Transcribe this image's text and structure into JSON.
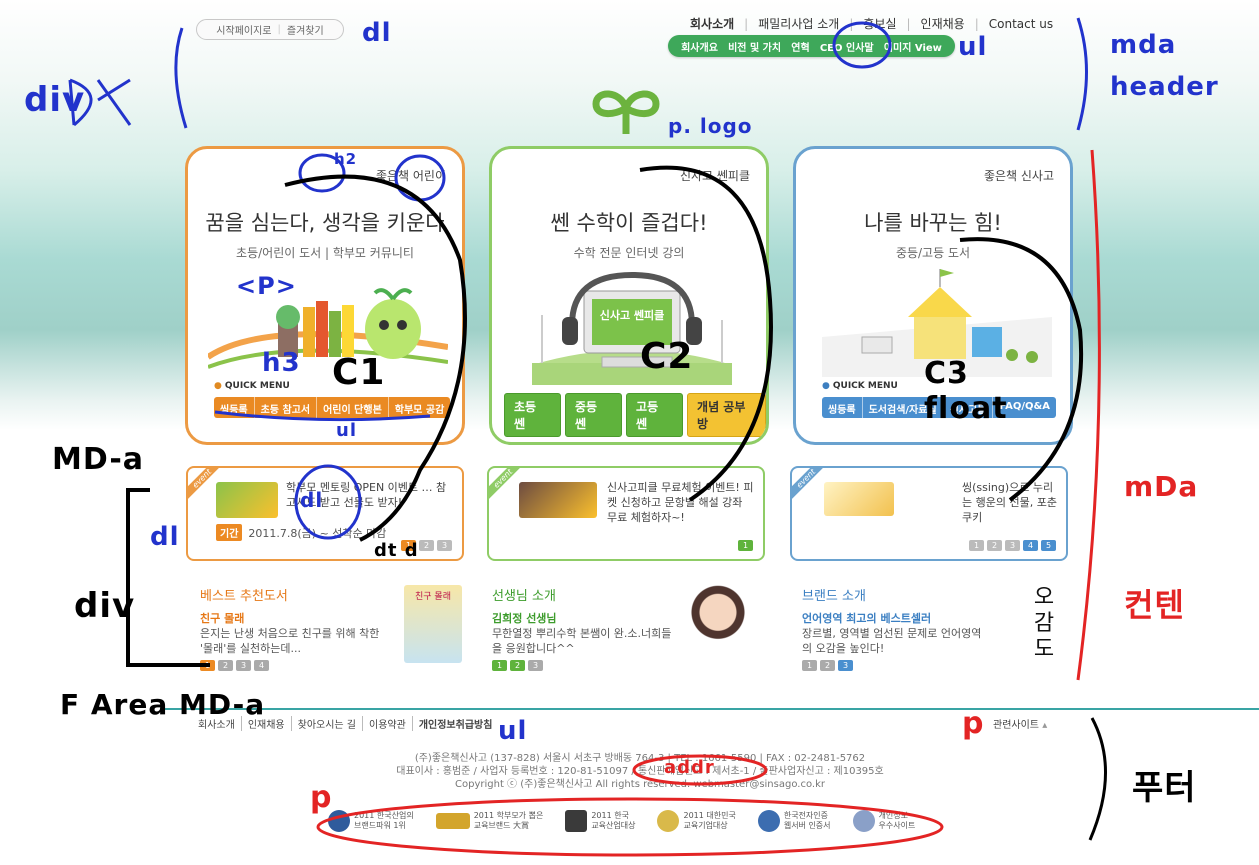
{
  "util": {
    "start_page": "시작페이지로",
    "bookmark": "즐겨찾기"
  },
  "gnb": {
    "items": [
      "회사소개",
      "패밀리사업 소개",
      "홍보실",
      "인재채용",
      "Contact us"
    ],
    "sub": [
      "회사개요",
      "비전 및 가치",
      "연혁",
      "CEO 인사말",
      "이미지 View"
    ]
  },
  "cards": [
    {
      "brand": "좋은책 어린이",
      "title": "꿈을 심는다, 생각을 키운다",
      "subtitle": "초등/어린이 도서 | 학부모 커뮤니티",
      "quick": "QUICK MENU",
      "menu": [
        "씽등록",
        "초등 참고서",
        "어린이 단행본",
        "학부모 공감"
      ]
    },
    {
      "brand": "신사고 쎈피클",
      "title": "쎈 수학이 즐겁다!",
      "subtitle": "수학 전문 인터넷 강의",
      "screen": "신사고 쎈피클",
      "menu": [
        "초등 쎈",
        "중등 쎈",
        "고등 쎈",
        "개념 공부방"
      ]
    },
    {
      "brand": "좋은책 신사고",
      "title": "나를 바꾸는 힘!",
      "subtitle": "중등/고등 도서",
      "quick": "QUICK MENU",
      "menu": [
        "씽등록",
        "도서검색/자료실",
        "신사고몰",
        "FAQ/Q&A"
      ]
    }
  ],
  "events": [
    {
      "label": "event",
      "text": "학부모 멘토링 OPEN 이벤트 … 참고서도 받고 선물도 받자!",
      "period_label": "기간",
      "period": "2011.7.8(금) ~ 선착순 마감",
      "pages": [
        "1",
        "2",
        "3"
      ]
    },
    {
      "label": "event",
      "text": "신사고피클 무료체험 이벤트! 피켓 신청하고 문항별 해설 강좌 무료 체험하자~!",
      "pages": [
        "1"
      ]
    },
    {
      "label": "event",
      "text": "씽(ssing)으로 누리는 행운의 선물, 포춘쿠키",
      "pages": [
        "1",
        "2",
        "3",
        "4",
        "5"
      ]
    }
  ],
  "info": [
    {
      "title": "베스트 추천도서",
      "item": "친구 몰래",
      "desc": "은지는 난생 처음으로 친구를 위해 착한 '몰래'를 실천하는데...",
      "pages": [
        "1",
        "2",
        "3",
        "4"
      ],
      "img_text": "친구 몰래"
    },
    {
      "title": "선생님 소개",
      "item": "김희정 선생님",
      "desc": "무한열정 뿌리수학 본쌤이 완.소.너희들을 응원합니다^^",
      "pages": [
        "1",
        "2",
        "3"
      ]
    },
    {
      "title": "브랜드 소개",
      "item": "언어영역 최고의 베스트셀러",
      "desc": "장르별, 영역별 엄선된 문제로 언어영역의 오감을 높인다!",
      "pages": [
        "1",
        "2",
        "3"
      ],
      "img_text": "오감도"
    }
  ],
  "footer": {
    "nav": [
      "회사소개",
      "인재채용",
      "찾아오시는 길",
      "이용약관",
      "개인정보취급방침"
    ],
    "related": "관련사이트",
    "addr1": "(주)좋은책신사고 (137-828) 서울시 서초구 방배동 764-3 | TEL : 1661-5590 | FAX : 02-2481-5762",
    "addr2": "대표이사 : 홍범준 / 사업자 등록번호 : 120-81-51097 / 통신판매업신고 : 제서초-1 / 출판사업자신고 : 제10395호",
    "addr3": "Copyright ⓒ (주)좋은책신사고 All rights reserved.  webmaster@sinsago.co.kr",
    "awards": [
      {
        "l1": "2011 한국산업의",
        "l2": "브랜드파워 1위"
      },
      {
        "l1": "2011 학부모가 뽑은",
        "l2": "교육브랜드 大賞"
      },
      {
        "l1": "2011 한국",
        "l2": "교육산업대상"
      },
      {
        "l1": "2011 대한민국",
        "l2": "교육기업대상"
      },
      {
        "l1": "한국전자인증",
        "l2": "웹서버 인증서"
      },
      {
        "l1": "개인정보",
        "l2": "우수사이트"
      }
    ]
  },
  "notes": {
    "div_left": "div",
    "dl": "dl",
    "ul": "ul",
    "p_logo": "p. logo",
    "mda_header": "mda header",
    "mdl": "mDa",
    "contents": "컨텐",
    "footer": "푸터",
    "h2": "h2",
    "p": "<P>",
    "h3": "h3",
    "c1": "C1",
    "c2": "C2",
    "c3": "C3 float",
    "ul2": "ul",
    "mda_label": "MD-a",
    "dl2": "dl",
    "dl3": "dl",
    "dt_dd": "dt d",
    "div2": "div",
    "f_area": "F Area MD-a",
    "ul3": "ul",
    "p_related": "p",
    "p_awards": "p",
    "addr_note": "addr"
  }
}
